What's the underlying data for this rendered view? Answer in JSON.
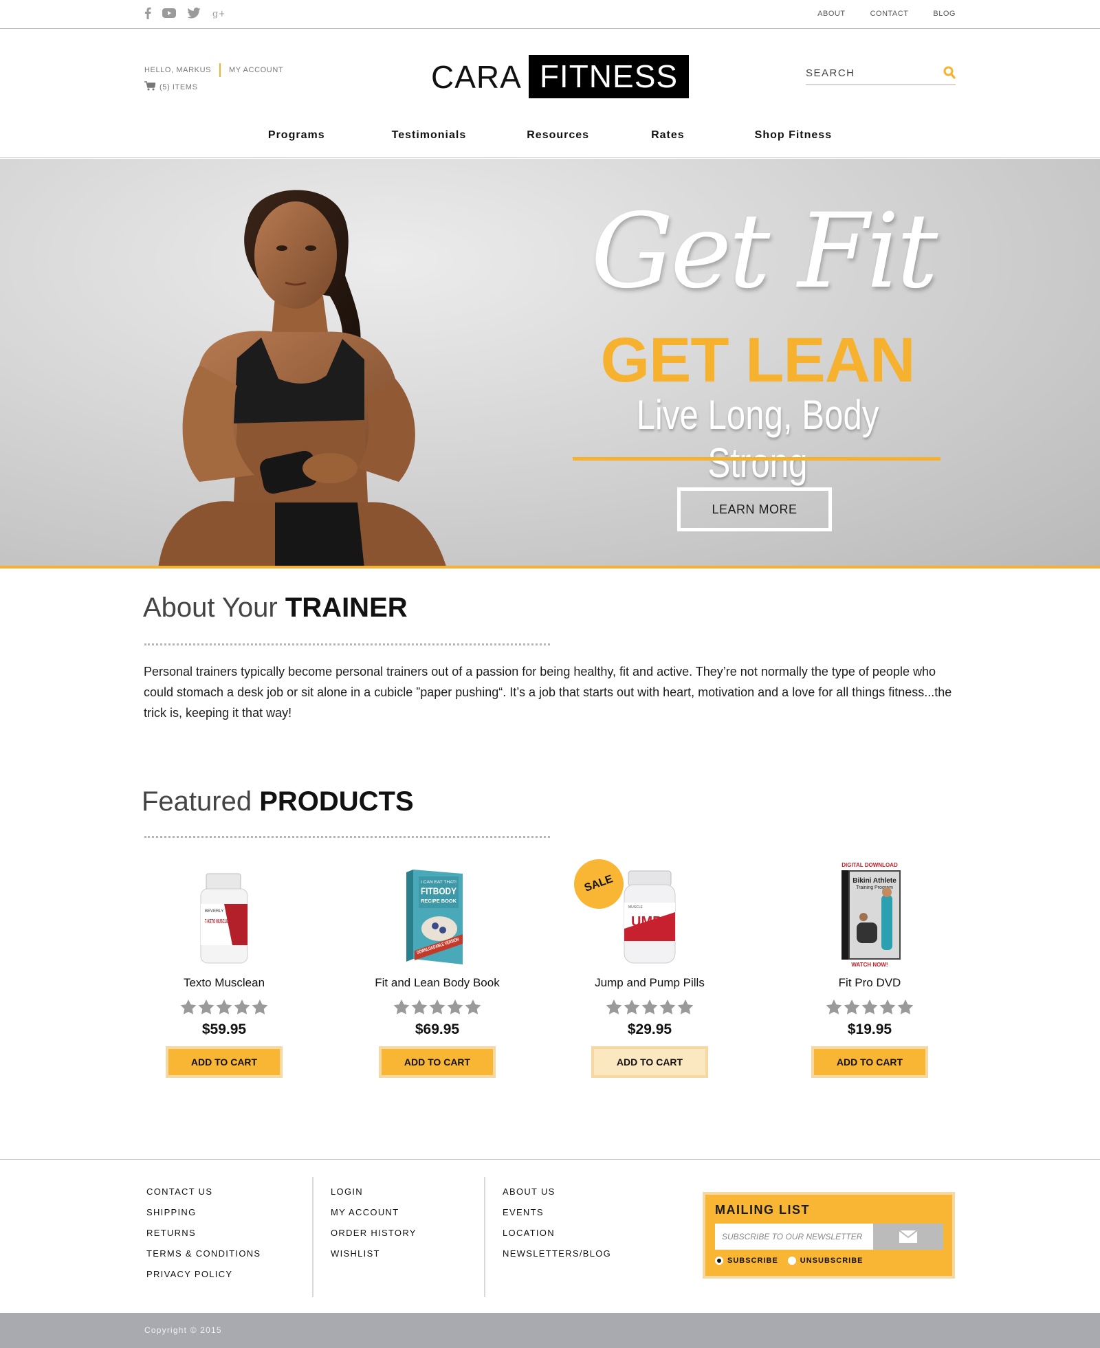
{
  "topbar": {
    "social": [
      "facebook-icon",
      "youtube-icon",
      "twitter-icon",
      "google-plus-icon"
    ],
    "links": [
      "ABOUT",
      "CONTACT",
      "BLOG"
    ]
  },
  "header": {
    "greeting": "HELLO, MARKUS",
    "my_account": "MY ACCOUNT",
    "cart_text": "(5) ITEMS",
    "logo_left": "CARA",
    "logo_right": "FITNESS",
    "search_placeholder": "SEARCH"
  },
  "nav": [
    "Programs",
    "Testimonials",
    "Resources",
    "Rates",
    "Shop Fitness"
  ],
  "hero": {
    "script": "Get Fit",
    "headline": "GET LEAN",
    "tagline": "Live Long, Body Strong",
    "button": "LEARN MORE"
  },
  "about": {
    "title_light": "About Your ",
    "title_bold": "TRAINER",
    "text": "Personal trainers typically become personal trainers out of a passion for being healthy, fit and active. They’re not normally the type of people who could stomach a desk job or sit alone in a cubicle ”paper pushing“. It’s a job that starts out with heart, motivation and a love for all things fitness...the trick is, keeping it that way!"
  },
  "products": {
    "title_light": "Featured ",
    "title_bold": "PRODUCTS",
    "items": [
      {
        "name": "Texto Musclean",
        "price": "$59.95",
        "rating": 5,
        "button": "ADD TO CART",
        "label_top": "BEVERLY",
        "label_main": "7-KETO MUSCLEAN"
      },
      {
        "name": "Fit and Lean Body Book",
        "price": "$69.95",
        "rating": 5,
        "button": "ADD TO CART",
        "label_top": "I CAN EAT THAT!",
        "label_main": "FITBODY",
        "label_sub": "RECIPE BOOK",
        "label_band": "DOWNLOADABLE VERSION"
      },
      {
        "name": "Jump and Pump Pills",
        "price": "$29.95",
        "rating": 5,
        "button": "ADD TO CART",
        "badge": "SALE",
        "label_main": "UMP"
      },
      {
        "name": "Fit Pro DVD",
        "price": "$19.95",
        "rating": 5,
        "button": "ADD TO CART",
        "label_top": "DIGITAL DOWNLOAD",
        "label_main": "Bikini Athlete",
        "label_sub": "Training Program",
        "label_bottom": "WATCH NOW!"
      }
    ]
  },
  "footer": {
    "col1": [
      "CONTACT US",
      "SHIPPING",
      "RETURNS",
      "TERMS & CONDITIONS",
      "PRIVACY POLICY"
    ],
    "col2": [
      "LOGIN",
      "MY ACCOUNT",
      "ORDER HISTORY",
      "WISHLIST"
    ],
    "col3": [
      "ABOUT US",
      "EVENTS",
      "LOCATION",
      "NEWSLETTERS/BLOG"
    ],
    "mailing": {
      "title": "MAILING LIST",
      "placeholder": "SUBSCRIBE TO OUR NEWSLETTER",
      "subscribe": "SUBSCRIBE",
      "unsubscribe": "UNSUBSCRIBE",
      "selected": "SUBSCRIBE"
    },
    "copyright": "Copyright © 2015"
  },
  "colors": {
    "accent": "#f6b22e",
    "footer_bar": "#a9aab0"
  }
}
